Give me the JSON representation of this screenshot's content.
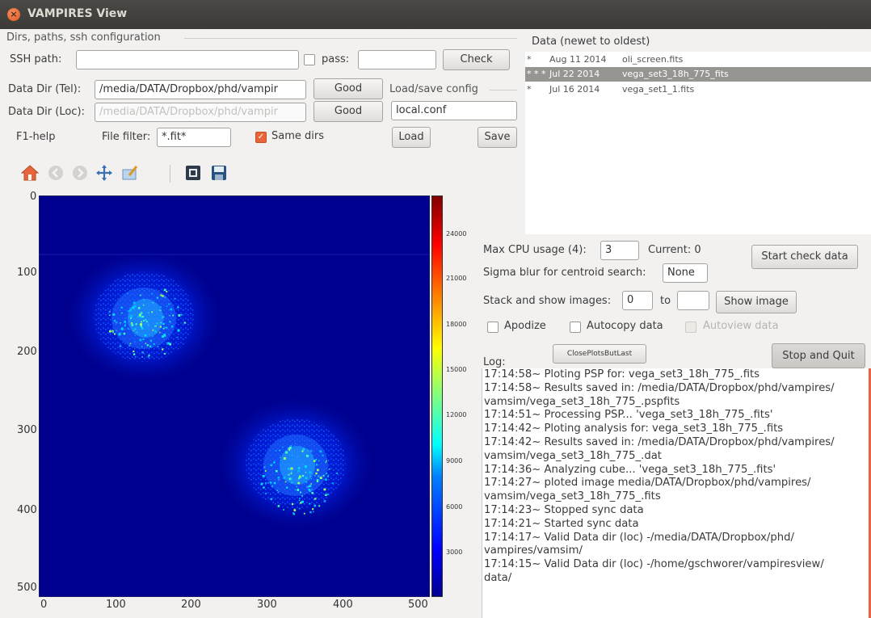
{
  "window": {
    "title": "VAMPIRES View"
  },
  "config": {
    "group_label": "Dirs, paths, ssh configuration",
    "ssh_path_label": "SSH path:",
    "ssh_path_value": "",
    "pass_label": "pass:",
    "pass_value": "",
    "check_label": "Check",
    "tel_label": "Data Dir (Tel):",
    "tel_value": "/media/DATA/Dropbox/phd/vampir",
    "tel_status": "Good",
    "loc_label": "Data Dir (Loc):",
    "loc_value": "/media/DATA/Dropbox/phd/vampir",
    "loc_status": "Good",
    "help_label": "F1-help",
    "filter_label": "File filter:",
    "filter_value": "*.fit*",
    "same_dirs_label": "Same dirs",
    "same_dirs_checked": true
  },
  "loadsave": {
    "group_label": "Load/save config",
    "config_value": "local.conf",
    "load_label": "Load",
    "save_label": "Save"
  },
  "data_list": {
    "header": "Data (newet to oldest)",
    "rows": [
      {
        "marker": "*",
        "date": "Aug 11 2014",
        "file": "oli_screen.fits",
        "selected": false
      },
      {
        "marker": "* * *",
        "date": "Jul 22 2014",
        "file": "vega_set3_18h_775_fits",
        "selected": true
      },
      {
        "marker": "*",
        "date": "Jul 16 2014",
        "file": "vega_set1_1.fits",
        "selected": false
      }
    ]
  },
  "toolbar": {
    "icons": [
      "home-icon",
      "back-icon",
      "forward-icon",
      "pan-icon",
      "configure-subplots-icon",
      "zoom-icon",
      "save-icon"
    ]
  },
  "plot": {
    "x_ticks": [
      "0",
      "100",
      "200",
      "300",
      "400",
      "500"
    ],
    "y_ticks": [
      "0",
      "100",
      "200",
      "300",
      "400",
      "500"
    ],
    "cbar_ticks": [
      "24000",
      "21000",
      "18000",
      "15000",
      "12000",
      "9000",
      "6000",
      "3000"
    ],
    "xlim": [
      0,
      512
    ],
    "ylim": [
      512,
      0
    ],
    "colormap": "jet",
    "speckle_centers": [
      [
        140,
        160
      ],
      [
        340,
        360
      ]
    ]
  },
  "controls": {
    "cpu_label": "Max CPU usage (4):",
    "cpu_value": "3",
    "current_label": "Current: 0",
    "start_label": "Start check data",
    "sigma_label": "Sigma blur for centroid search:",
    "sigma_value": "None",
    "stack_label": "Stack and show images:",
    "stack_from": "0",
    "to_label": "to",
    "stack_to": "",
    "show_label": "Show image",
    "apodize_label": "Apodize",
    "autocopy_label": "Autocopy data",
    "autoview_label": "Autoview data",
    "close_plots_label": "ClosePlotsButLast",
    "stop_label": "Stop and Quit",
    "log_label": "Log:"
  },
  "log": [
    "17:14:58~ Ploting PSP for: vega_set3_18h_775_.fits",
    "17:14:58~ Results saved in: /media/DATA/Dropbox/phd/vampires/",
    "vamsim/vega_set3_18h_775_.pspfits",
    "17:14:51~ Processing PSP... 'vega_set3_18h_775_.fits'",
    "17:14:42~ Ploting analysis for: vega_set3_18h_775_.fits",
    "17:14:42~ Results saved in: /media/DATA/Dropbox/phd/vampires/",
    "vamsim/vega_set3_18h_775_.dat",
    "17:14:36~ Analyzing cube... 'vega_set3_18h_775_.fits'",
    "17:14:27~ ploted image media/DATA/Dropbox/phd/vampires/",
    "vamsim/vega_set3_18h_775_.fits",
    "17:14:23~ Stopped sync data",
    "17:14:21~ Started sync data",
    "17:14:17~ Valid Data dir (loc) -/media/DATA/Dropbox/phd/",
    "vampires/vamsim/",
    "17:14:15~ Valid Data dir (loc) -/home/gschworer/vampiresview/",
    "data/"
  ]
}
